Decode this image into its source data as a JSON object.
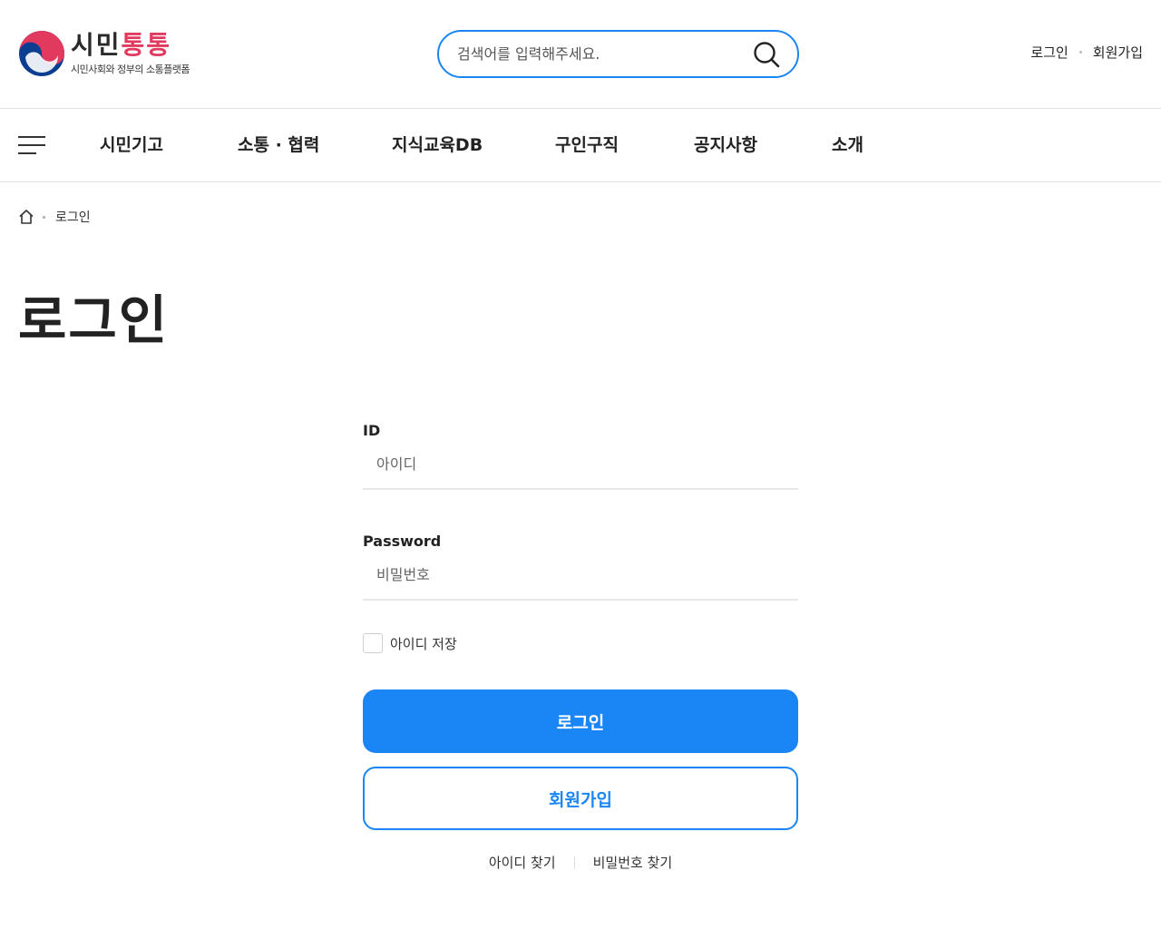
{
  "header": {
    "logo_title_part1": "시민",
    "logo_title_part2": "통통",
    "logo_subtitle": "시민사회와 정부의 소통플랫폼",
    "search_placeholder": "검색어를 입력해주세요.",
    "util_login": "로그인",
    "util_join": "회원가입"
  },
  "nav": {
    "items": [
      "시민기고",
      "소통 · 협력",
      "지식교육DB",
      "구인구직",
      "공지사항",
      "소개"
    ]
  },
  "breadcrumb": {
    "current": "로그인"
  },
  "page_title": "로그인",
  "form": {
    "id_label": "ID",
    "id_placeholder": "아이디",
    "pw_label": "Password",
    "pw_placeholder": "비밀번호",
    "remember_label": "아이디 저장",
    "login_button": "로그인",
    "join_button": "회원가입",
    "find_id": "아이디 찾기",
    "find_pw": "비밀번호 찾기"
  },
  "colors": {
    "primary": "#1a85f5",
    "logo_accent": "#e23a5e",
    "text": "#222222"
  },
  "icons": {
    "search": "search-icon",
    "home": "home-icon",
    "menu": "hamburger-menu-icon"
  }
}
